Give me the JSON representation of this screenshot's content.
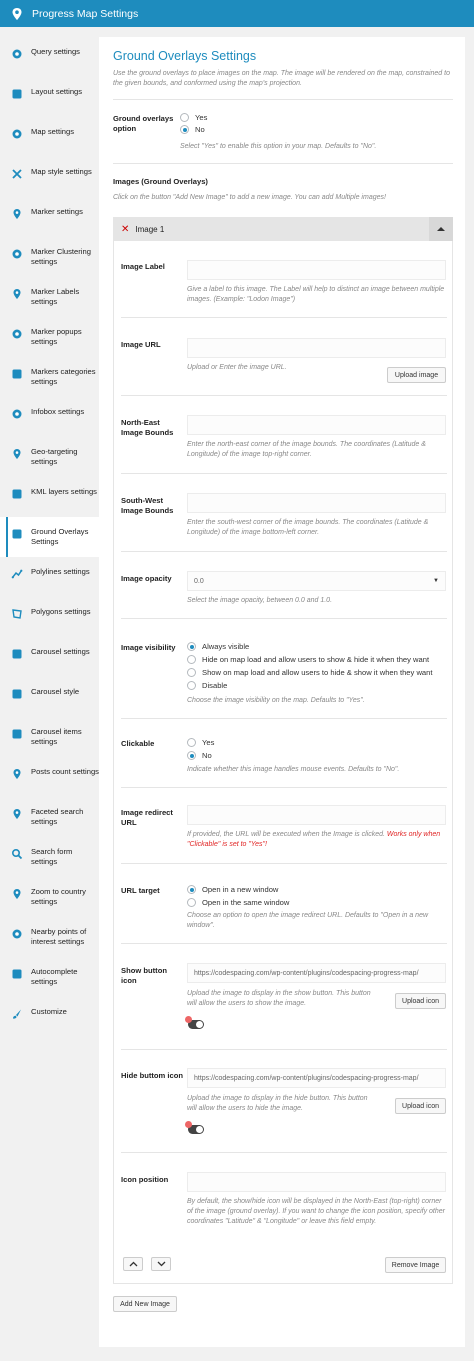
{
  "app": {
    "title": "Progress Map Settings",
    "logo_icon": "map-logo-icon"
  },
  "sidebar": {
    "items": [
      {
        "label": "Query settings",
        "icon": "gear-icon"
      },
      {
        "label": "Layout settings",
        "icon": "layout-icon"
      },
      {
        "label": "Map settings",
        "icon": "map-gear-icon"
      },
      {
        "label": "Map style settings",
        "icon": "paint-icon"
      },
      {
        "label": "Marker settings",
        "icon": "marker-icon"
      },
      {
        "label": "Marker Clustering settings",
        "icon": "cluster-icon"
      },
      {
        "label": "Marker Labels settings",
        "icon": "marker-label-icon"
      },
      {
        "label": "Marker popups settings",
        "icon": "popup-icon"
      },
      {
        "label": "Markers categories settings",
        "icon": "categories-icon"
      },
      {
        "label": "Infobox settings",
        "icon": "infobox-icon"
      },
      {
        "label": "Geo-targeting settings",
        "icon": "geo-target-icon"
      },
      {
        "label": "KML layers settings",
        "icon": "layers-icon"
      },
      {
        "label": "Ground Overlays Settings",
        "icon": "overlay-icon"
      },
      {
        "label": "Polylines settings",
        "icon": "polyline-icon"
      },
      {
        "label": "Polygons settings",
        "icon": "polygon-icon"
      },
      {
        "label": "Carousel settings",
        "icon": "carousel-icon"
      },
      {
        "label": "Carousel style",
        "icon": "carousel-style-icon"
      },
      {
        "label": "Carousel items settings",
        "icon": "carousel-items-icon"
      },
      {
        "label": "Posts count settings",
        "icon": "posts-count-icon"
      },
      {
        "label": "Faceted search settings",
        "icon": "faceted-search-icon"
      },
      {
        "label": "Search form settings",
        "icon": "search-icon"
      },
      {
        "label": "Zoom to country settings",
        "icon": "zoom-country-icon"
      },
      {
        "label": "Nearby points of interest settings",
        "icon": "nearby-icon"
      },
      {
        "label": "Autocomplete settings",
        "icon": "autocomplete-icon"
      },
      {
        "label": "Customize",
        "icon": "brush-icon"
      }
    ],
    "active_index": 12
  },
  "main": {
    "title": "Ground Overlays Settings",
    "intro": "Use the ground overlays to place images on the map. The image will be rendered on the map, constrained to the given bounds, and conformed using the map's projection.",
    "ground_overlays_option": {
      "label": "Ground overlays option",
      "options": [
        "Yes",
        "No"
      ],
      "selected": "No",
      "desc": "Select \"Yes\" to enable this option in your map. Defaults to \"No\"."
    },
    "images_section": {
      "label": "Images (Ground Overlays)",
      "desc": "Click on the button \"Add New Image\" to add a new image. You can add Multiple images!"
    },
    "image": {
      "header": "Image 1",
      "label_field": {
        "label": "Image Label",
        "value": "",
        "desc": "Give a label to this image. The Label will help to distinct an image between multiple images. (Example: \"Lodon Image\")"
      },
      "url_field": {
        "label": "Image URL",
        "value": "",
        "desc": "Upload or Enter the image URL.",
        "button": "Upload image"
      },
      "ne_bounds": {
        "label": "North-East Image Bounds",
        "value": "",
        "desc": "Enter the north-east corner of the image bounds. The coordinates (Latitude & Longitude) of the image top-right corner."
      },
      "sw_bounds": {
        "label": "South-West Image Bounds",
        "value": "",
        "desc": "Enter the south-west corner of the image bounds. The coordinates (Latitude & Longitude) of the image bottom-left corner."
      },
      "opacity": {
        "label": "Image opacity",
        "value": "0.0",
        "desc": "Select the image opacity, between 0.0 and 1.0."
      },
      "visibility": {
        "label": "Image visibility",
        "options": [
          "Always visible",
          "Hide on map load and allow users to show & hide it when they want",
          "Show on map load and allow users to hide & show it when they want",
          "Disable"
        ],
        "selected": "Always visible",
        "desc": "Choose the image visibility on the map. Defaults to \"Yes\"."
      },
      "clickable": {
        "label": "Clickable",
        "options": [
          "Yes",
          "No"
        ],
        "selected": "No",
        "desc": "Indicate whether this image handles mouse events. Defaults to \"No\"."
      },
      "redirect_url": {
        "label": "Image redirect URL",
        "value": "",
        "desc": "If provided, the URL will be executed when the Image is clicked.",
        "desc_red": "Works only when \"Clickable\" is set to \"Yes\"!"
      },
      "url_target": {
        "label": "URL target",
        "options": [
          "Open in a new window",
          "Open in the same window"
        ],
        "selected": "Open in a new window",
        "desc": "Choose an option to open the image redirect URL. Defaults to \"Open in a new window\"."
      },
      "show_button_icon": {
        "label": "Show button icon",
        "value": "https://codespacing.com/wp-content/plugins/codespacing-progress-map/",
        "desc": "Upload the image to display in the show button. This button will allow the users to show the image.",
        "button": "Upload icon"
      },
      "hide_button_icon": {
        "label": "Hide buttom icon",
        "value": "https://codespacing.com/wp-content/plugins/codespacing-progress-map/",
        "desc": "Upload the image to display in the hide button. This button will allow the users to hide the image.",
        "button": "Upload icon"
      },
      "icon_position": {
        "label": "Icon position",
        "value": "",
        "desc": "By default, the show/hide icon will be displayed in the North-East (top-right) corner of the image (ground overlay). If you want to change the icon position, specify other coordinates \"Latitude\" & \"Longitude\" or leave this field empty."
      },
      "remove_button": "Remove Image"
    },
    "add_button": "Add New Image"
  },
  "colors": {
    "accent": "#1e8cbe",
    "warning": "#e02525"
  }
}
